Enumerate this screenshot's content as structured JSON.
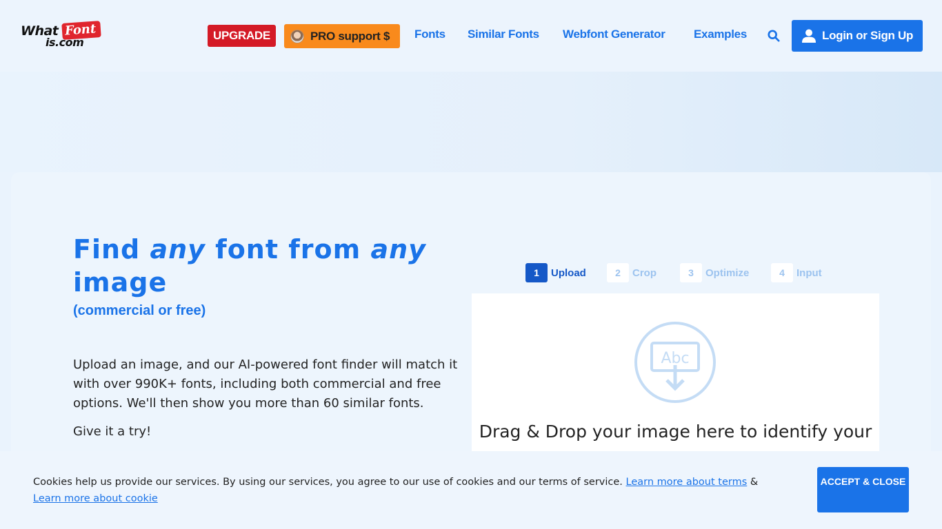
{
  "header": {
    "logo": {
      "what": "What",
      "font": "Font",
      "iscom": "is.com"
    },
    "upgrade_label": "UPGRADE",
    "pro_label": "PRO support $",
    "nav": [
      {
        "label": "Fonts"
      },
      {
        "label": "Similar Fonts"
      },
      {
        "label": "Webfont Generator"
      },
      {
        "label": "Examples"
      }
    ],
    "search_icon": "search-icon",
    "login_label": "Login or Sign Up"
  },
  "hero": {
    "title_part1": "Find ",
    "title_em1": "any",
    "title_part2": " font from ",
    "title_em2": "any",
    "title_part3": " image",
    "subtitle": "(commercial or free)",
    "description": "Upload an image, and our AI-powered font finder will match it with over 990K+ fonts, including both commercial and free options. We'll then show you more than 60 similar fonts.",
    "cta": "Give it a try!"
  },
  "steps": [
    {
      "num": "1",
      "label": "Upload",
      "active": true
    },
    {
      "num": "2",
      "label": "Crop",
      "active": false
    },
    {
      "num": "3",
      "label": "Optimize",
      "active": false
    },
    {
      "num": "4",
      "label": "Input",
      "active": false
    }
  ],
  "dropzone": {
    "icon_text": "Abc",
    "text": "Drag & Drop your image here to identify your"
  },
  "cookie": {
    "text": "Cookies help us provide our services. By using our services, you agree to our use of cookies and our terms of service.",
    "link_terms": "Learn more about terms",
    "amp": "&",
    "link_cookie": "Learn more about cookie",
    "accept_label": "ACCEPT & CLOSE"
  },
  "colors": {
    "brand_blue": "#1a73e8",
    "upgrade_red": "#d41a26",
    "pro_orange": "#f98a1c"
  }
}
